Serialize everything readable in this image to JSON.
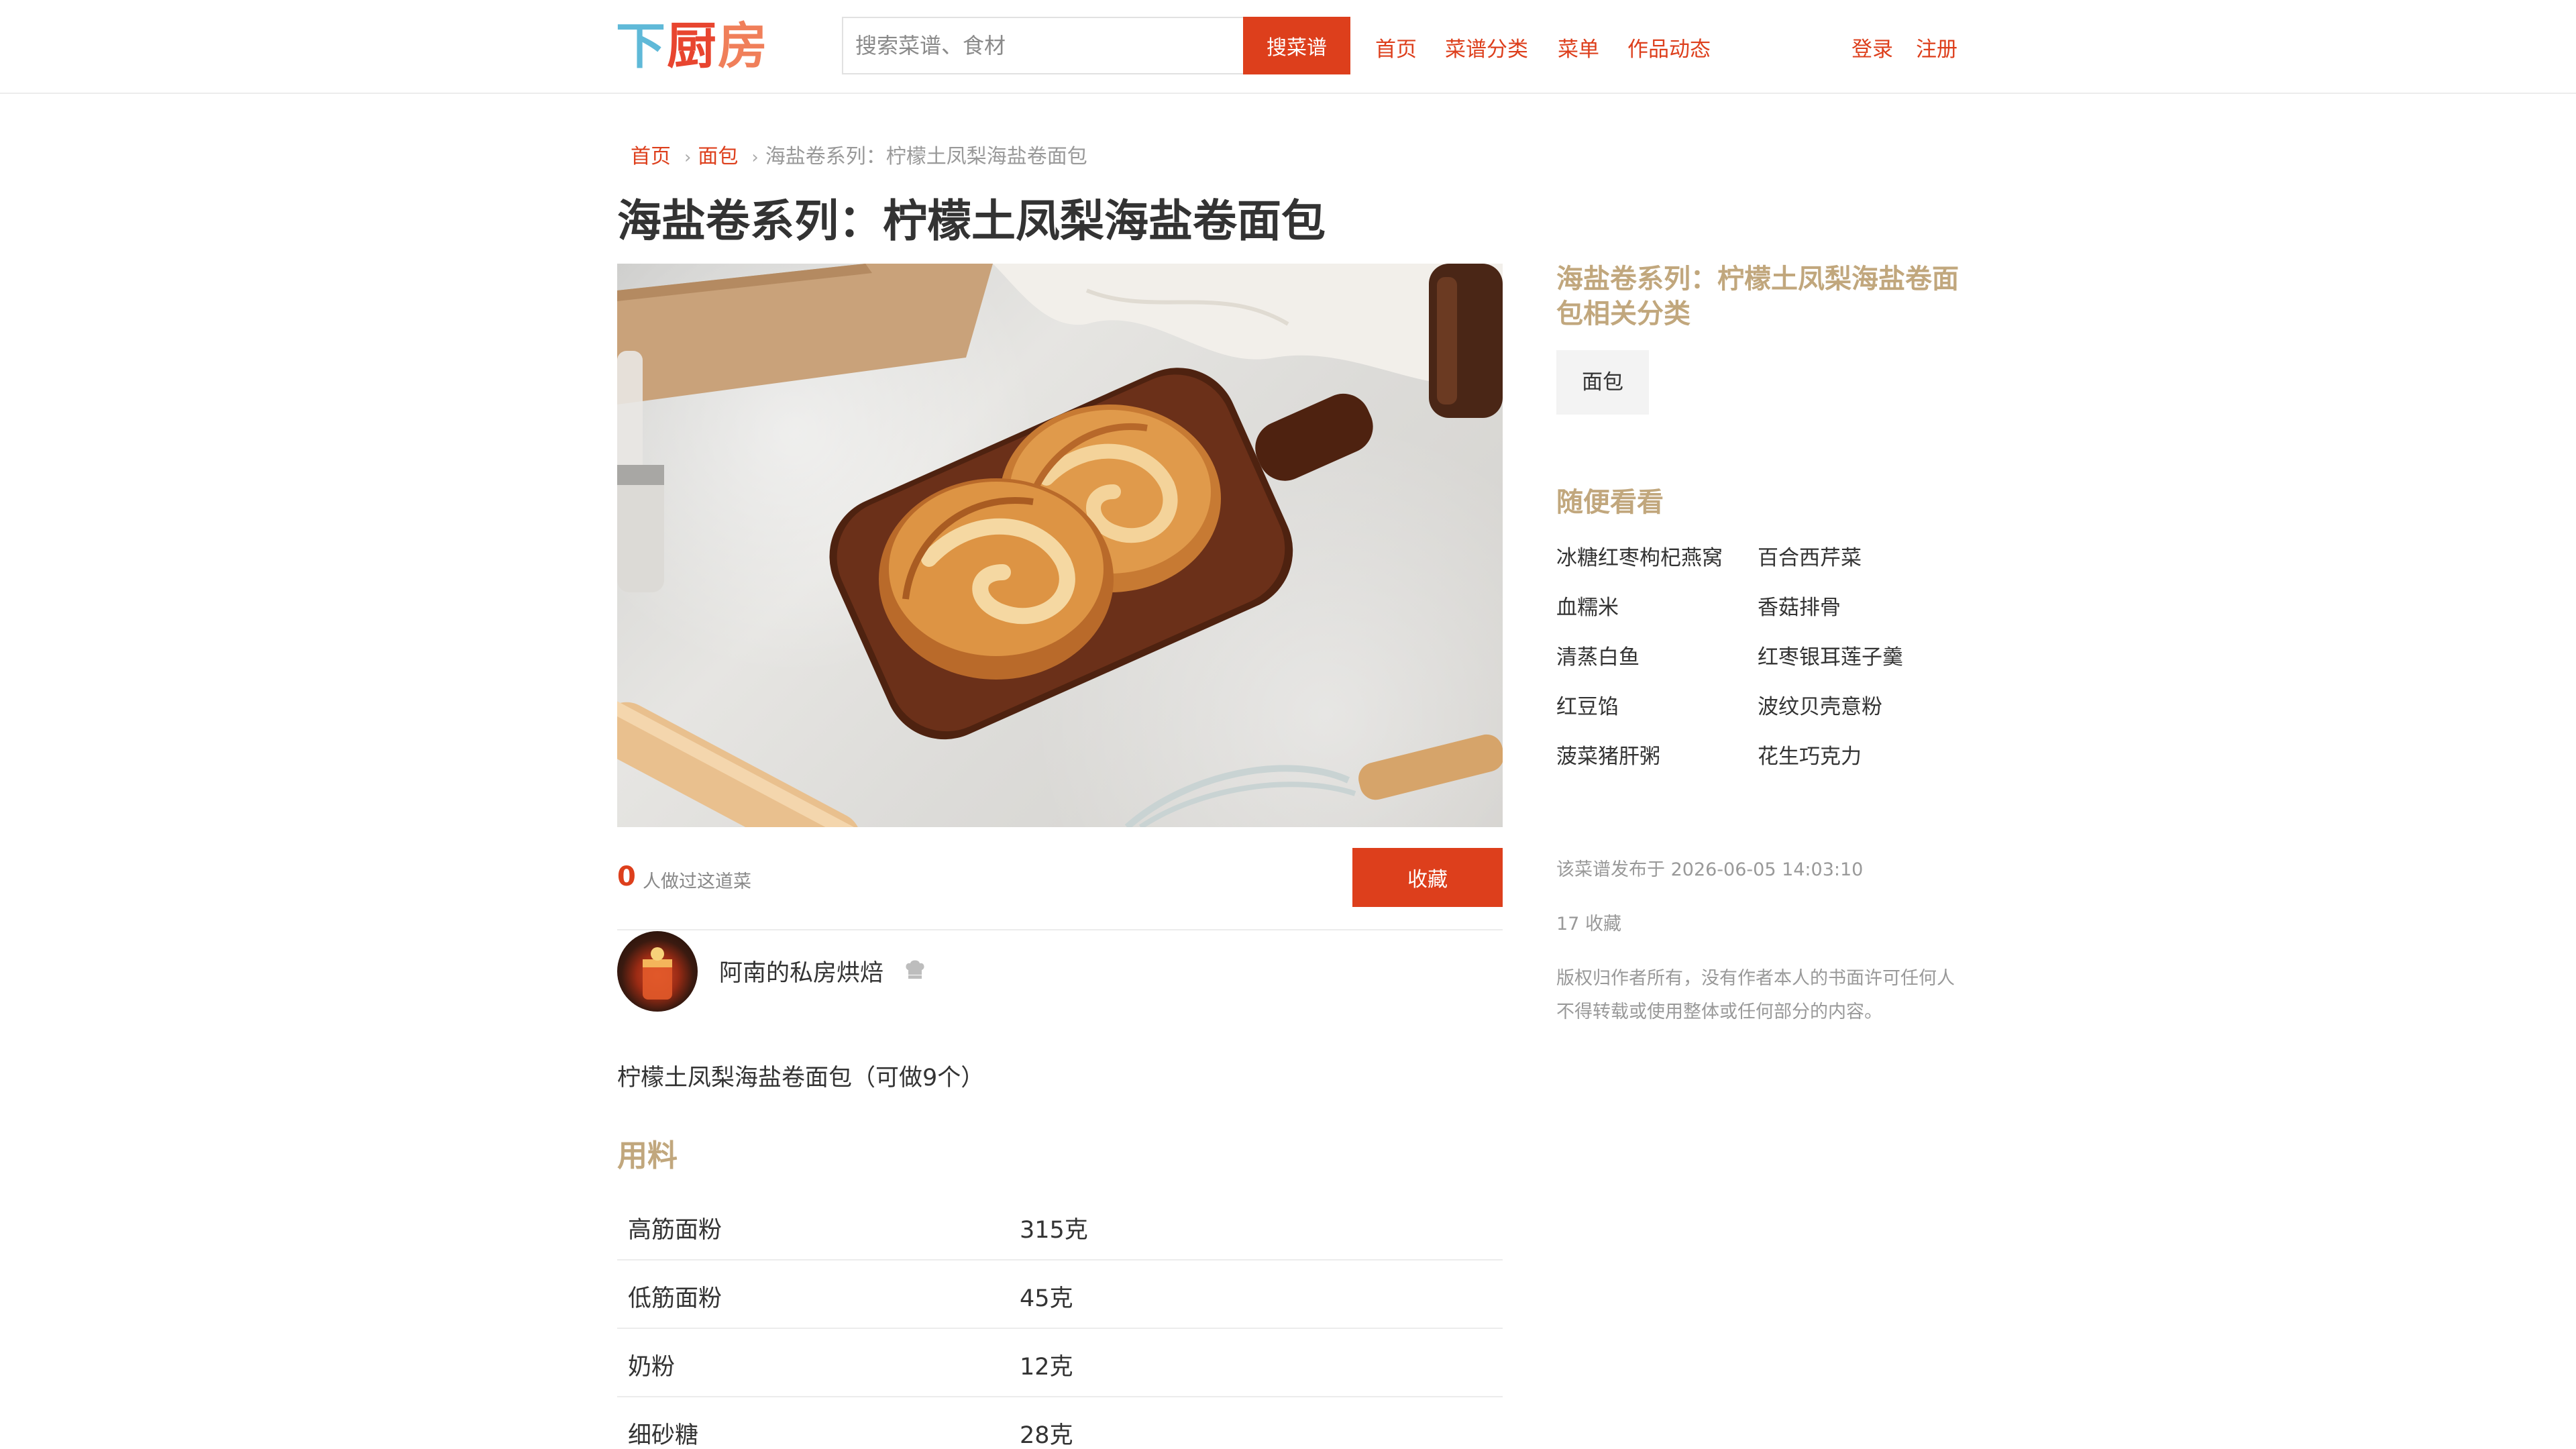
{
  "header": {
    "logo_part1": "下",
    "logo_part2": "厨",
    "logo_part3": "房",
    "search_placeholder": "搜索菜谱、食材",
    "search_button": "搜菜谱",
    "nav": [
      "首页",
      "菜谱分类",
      "菜单",
      "作品动态"
    ],
    "login": "登录",
    "register": "注册"
  },
  "breadcrumb": {
    "home": "首页",
    "category": "面包",
    "current": "海盐卷系列：柠檬土凤梨海盐卷面包"
  },
  "recipe": {
    "title": "海盐卷系列：柠檬土凤梨海盐卷面包",
    "made_count": "0",
    "made_label": "人做过这道菜",
    "collect_button": "收藏",
    "author": "阿南的私房烘焙",
    "description": "柠檬土凤梨海盐卷面包（可做9个）",
    "ingredients_title": "用料",
    "ingredients": [
      {
        "name": "高筋面粉",
        "amount": "315克"
      },
      {
        "name": "低筋面粉",
        "amount": "45克"
      },
      {
        "name": "奶粉",
        "amount": "12克"
      },
      {
        "name": "细砂糖",
        "amount": "28克"
      }
    ]
  },
  "sidebar": {
    "category_title": "海盐卷系列：柠檬土凤梨海盐卷面包相关分类",
    "category_tag": "面包",
    "random_title": "随便看看",
    "random_items": [
      "冰糖红枣枸杞燕窝",
      "百合西芹菜",
      "血糯米",
      "香菇排骨",
      "清蒸白鱼",
      "红枣银耳莲子羹",
      "红豆馅",
      "波纹贝壳意粉",
      "菠菜猪肝粥",
      "花生巧克力"
    ],
    "publish_info": "该菜谱发布于 2026-06-05 14:03:10",
    "collect_info": "17 收藏",
    "copyright": "版权归作者所有，没有作者本人的书面许可任何人不得转载或使用整体或任何部分的内容。"
  },
  "colors": {
    "brand_red": "#dd3f1c",
    "section_gold": "#c1a77d"
  }
}
